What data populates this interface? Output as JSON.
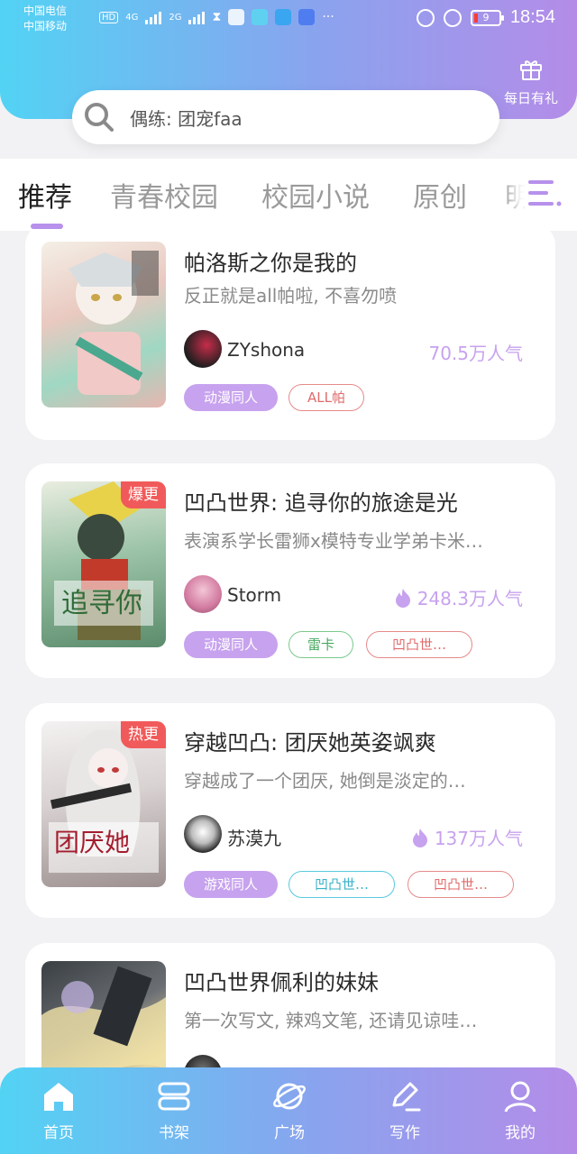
{
  "status_bar": {
    "carrier1": "中国电信",
    "carrier2": "中国移动",
    "network1": "4G",
    "network2": "2G",
    "battery": "9",
    "time": "18:54"
  },
  "header": {
    "daily_gift_label": "每日有礼",
    "search_placeholder": "偶练: 团宠faa"
  },
  "tabs": [
    {
      "label": "推荐",
      "active": true
    },
    {
      "label": "青春校园",
      "active": false
    },
    {
      "label": "校园小说",
      "active": false
    },
    {
      "label": "原创",
      "active": false
    },
    {
      "label": "明星",
      "active": false
    }
  ],
  "books": [
    {
      "title": "帕洛斯之你是我的",
      "desc": "反正就是all帕啦, 不喜勿喷",
      "author": "ZYshona",
      "popularity": "70.5万人气",
      "hot": false,
      "badge": "",
      "tags": [
        {
          "label": "动漫同人",
          "style": "filled"
        },
        {
          "label": "ALL帕",
          "style": "red"
        }
      ]
    },
    {
      "title": "凹凸世界: 追寻你的旅途是光",
      "desc": "表演系学长雷狮x模特专业学弟卡米…",
      "author": "Storm",
      "popularity": "248.3万人气",
      "hot": true,
      "badge": "爆更",
      "tags": [
        {
          "label": "动漫同人",
          "style": "filled"
        },
        {
          "label": "雷卡",
          "style": "green"
        },
        {
          "label": "凹凸世…",
          "style": "red"
        }
      ]
    },
    {
      "title": "穿越凹凸: 团厌她英姿飒爽",
      "desc": "穿越成了一个团厌, 她倒是淡定的…",
      "author": "苏漠九",
      "popularity": "137万人气",
      "hot": true,
      "badge": "热更",
      "tags": [
        {
          "label": "游戏同人",
          "style": "filled"
        },
        {
          "label": "凹凸世…",
          "style": "cyan"
        },
        {
          "label": "凹凸世…",
          "style": "red"
        }
      ]
    },
    {
      "title": "凹凸世界佩利的妹妹",
      "desc": "第一次写文, 辣鸡文笔, 还请见谅哇…",
      "author": "",
      "popularity": "",
      "hot": false,
      "badge": "",
      "tags": []
    }
  ],
  "bottom_nav": [
    {
      "label": "首页",
      "icon": "home-icon"
    },
    {
      "label": "书架",
      "icon": "bookshelf-icon"
    },
    {
      "label": "广场",
      "icon": "planet-icon"
    },
    {
      "label": "写作",
      "icon": "pen-icon"
    },
    {
      "label": "我的",
      "icon": "user-icon"
    }
  ],
  "colors": {
    "gradient_start": "#52d3f4",
    "gradient_end": "#b48ce8",
    "accent_purple": "#c7a2ee",
    "badge_red": "#f15a5a"
  }
}
